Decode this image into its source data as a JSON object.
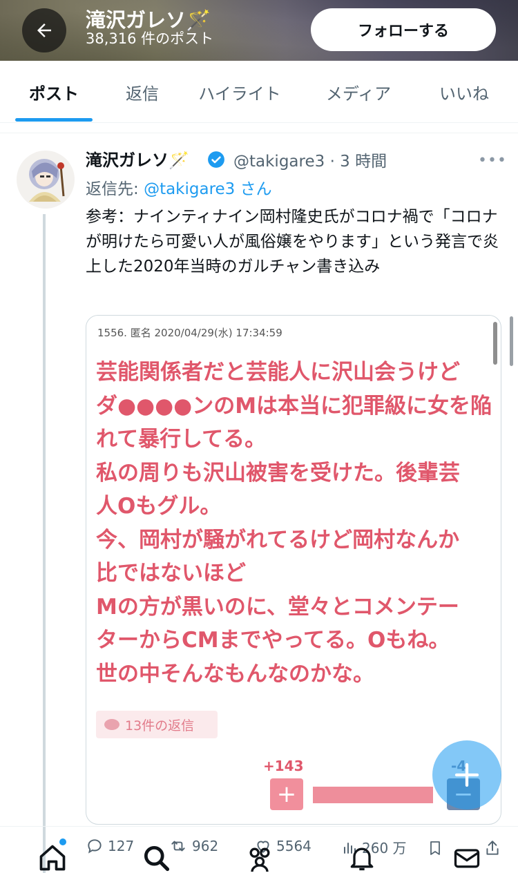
{
  "header": {
    "title": "滝沢ガレソ🪄",
    "post_count": "38,316 件のポスト",
    "follow_label": "フォローする",
    "back_icon": "arrow-left-icon"
  },
  "tabs": [
    {
      "label": "ポスト",
      "active": true
    },
    {
      "label": "返信",
      "active": false
    },
    {
      "label": "ハイライト",
      "active": false
    },
    {
      "label": "メディア",
      "active": false
    },
    {
      "label": "いいね",
      "active": false
    }
  ],
  "tweet": {
    "author": "滝沢ガレソ🪄",
    "handle": "@takigare3",
    "time": "· 3 時間",
    "more": "•••",
    "reply_prefix": "返信先:",
    "reply_handle": "@takigare3 さん",
    "text": "参考：ナインティナイン岡村隆史氏がコロナ禍で「コロナが明けたら可愛い人が風俗嬢をやります」という発言で炎上した2020年当時のガルチャン書き込み",
    "accent_color": "#1d9bf0"
  },
  "media": {
    "meta": "1556. 匿名 2020/04/29(水) 17:34:59",
    "lines": [
      "芸能関係者だと芸能人に沢山会うけど",
      "ダ●●●●ンのMは本当に犯罪級に女を陥",
      "れて暴行してる。",
      "私の周りも沢山被害を受けた。後輩芸",
      "人Oもグル。",
      "今、岡村が騒がれてるけど岡村なんか",
      "比ではないほど",
      "Mの方が黒いのに、堂々とコメンテー",
      "ターからCMまでやってる。Oもね。",
      "世の中そんなもんなのかな。"
    ],
    "reply_chip": "13件の返信",
    "plus_votes": "+143",
    "minus_votes": "-4",
    "plus_symbol": "+",
    "minus_symbol": "−",
    "text_color": "#e0576b"
  },
  "actions": {
    "replies": "127",
    "reposts": "962",
    "likes": "5564",
    "views": "260 万"
  },
  "nav": [
    "home-icon",
    "search-icon",
    "communities-icon",
    "notifications-icon",
    "messages-icon"
  ],
  "fab_symbol": "+"
}
